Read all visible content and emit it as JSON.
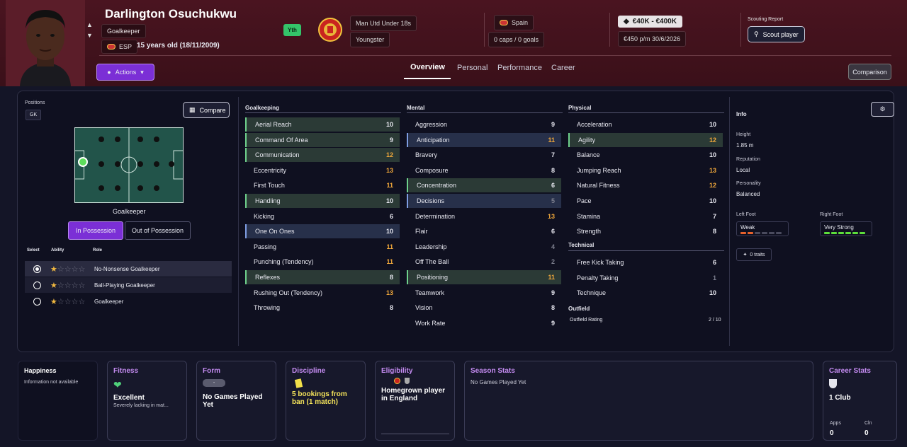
{
  "player": {
    "name": "Darlington Osuchukwu",
    "position": "Goalkeeper",
    "nation_code": "ESP",
    "age_text": "15 years old (18/11/2009)",
    "badge": "Yth"
  },
  "club": {
    "name": "Man Utd Under 18s",
    "status": "Youngster"
  },
  "nation": {
    "name": "Spain",
    "caps": "0 caps / 0 goals"
  },
  "value": {
    "range": "€40K - €400K",
    "wage_contract": "€450 p/m   30/6/2026"
  },
  "scouting": {
    "title": "Scouting Report",
    "button": "Scout player"
  },
  "actions_label": "Actions",
  "tabs": [
    "Overview",
    "Personal",
    "Performance",
    "Career"
  ],
  "comparison_label": "Comparison",
  "positions": {
    "label": "Positions",
    "value": "GK",
    "compare": "Compare",
    "pitch_label": "Goalkeeper",
    "in_possession": "In Possession",
    "out_possession": "Out of Possession"
  },
  "roles": {
    "headers": {
      "select": "Select",
      "ability": "Ability",
      "role": "Role"
    },
    "items": [
      {
        "name": "No-Nonsense Goalkeeper",
        "stars": 1,
        "selected": true
      },
      {
        "name": "Ball-Playing Goalkeeper",
        "stars": 1,
        "selected": false
      },
      {
        "name": "Goalkeeper",
        "stars": 1,
        "selected": false
      }
    ]
  },
  "goalkeeping": {
    "title": "Goalkeeping",
    "items": [
      {
        "name": "Aerial Reach",
        "value": "10",
        "style": "hl",
        "color": "w"
      },
      {
        "name": "Command Of Area",
        "value": "9",
        "style": "hl",
        "color": "w"
      },
      {
        "name": "Communication",
        "value": "12",
        "style": "hl",
        "color": "o"
      },
      {
        "name": "Eccentricity",
        "value": "13",
        "style": "",
        "color": "o"
      },
      {
        "name": "First Touch",
        "value": "11",
        "style": "",
        "color": "o"
      },
      {
        "name": "Handling",
        "value": "10",
        "style": "hl",
        "color": "w"
      },
      {
        "name": "Kicking",
        "value": "6",
        "style": "",
        "color": "w"
      },
      {
        "name": "One On Ones",
        "value": "10",
        "style": "hlb",
        "color": "w"
      },
      {
        "name": "Passing",
        "value": "11",
        "style": "",
        "color": "o"
      },
      {
        "name": "Punching (Tendency)",
        "value": "11",
        "style": "",
        "color": "o"
      },
      {
        "name": "Reflexes",
        "value": "8",
        "style": "hl",
        "color": "w"
      },
      {
        "name": "Rushing Out (Tendency)",
        "value": "13",
        "style": "",
        "color": "o"
      },
      {
        "name": "Throwing",
        "value": "8",
        "style": "",
        "color": "w"
      }
    ]
  },
  "mental": {
    "title": "Mental",
    "items": [
      {
        "name": "Aggression",
        "value": "9",
        "style": "",
        "color": "w"
      },
      {
        "name": "Anticipation",
        "value": "11",
        "style": "hlb",
        "color": "o"
      },
      {
        "name": "Bravery",
        "value": "7",
        "style": "",
        "color": "w"
      },
      {
        "name": "Composure",
        "value": "8",
        "style": "",
        "color": "w"
      },
      {
        "name": "Concentration",
        "value": "6",
        "style": "hl",
        "color": "w"
      },
      {
        "name": "Decisions",
        "value": "5",
        "style": "hlb",
        "color": "g"
      },
      {
        "name": "Determination",
        "value": "13",
        "style": "",
        "color": "o"
      },
      {
        "name": "Flair",
        "value": "6",
        "style": "",
        "color": "w"
      },
      {
        "name": "Leadership",
        "value": "4",
        "style": "",
        "color": "g"
      },
      {
        "name": "Off The Ball",
        "value": "2",
        "style": "",
        "color": "g"
      },
      {
        "name": "Positioning",
        "value": "11",
        "style": "hl",
        "color": "o"
      },
      {
        "name": "Teamwork",
        "value": "9",
        "style": "",
        "color": "w"
      },
      {
        "name": "Vision",
        "value": "8",
        "style": "",
        "color": "w"
      },
      {
        "name": "Work Rate",
        "value": "9",
        "style": "",
        "color": "w"
      }
    ]
  },
  "physical": {
    "title": "Physical",
    "items": [
      {
        "name": "Acceleration",
        "value": "10",
        "style": "",
        "color": "w"
      },
      {
        "name": "Agility",
        "value": "12",
        "style": "hl",
        "color": "o"
      },
      {
        "name": "Balance",
        "value": "10",
        "style": "",
        "color": "w"
      },
      {
        "name": "Jumping Reach",
        "value": "13",
        "style": "",
        "color": "o"
      },
      {
        "name": "Natural Fitness",
        "value": "12",
        "style": "",
        "color": "o"
      },
      {
        "name": "Pace",
        "value": "10",
        "style": "",
        "color": "w"
      },
      {
        "name": "Stamina",
        "value": "7",
        "style": "",
        "color": "w"
      },
      {
        "name": "Strength",
        "value": "8",
        "style": "",
        "color": "w"
      }
    ]
  },
  "technical": {
    "title": "Technical",
    "items": [
      {
        "name": "Free Kick Taking",
        "value": "6",
        "style": "",
        "color": "w"
      },
      {
        "name": "Penalty Taking",
        "value": "1",
        "style": "",
        "color": "g"
      },
      {
        "name": "Technique",
        "value": "10",
        "style": "",
        "color": "w"
      }
    ]
  },
  "outfield": {
    "title": "Outfield",
    "rating_label": "Outfield Rating",
    "rating": "2 / 10"
  },
  "info": {
    "title": "Info",
    "height_label": "Height",
    "height": "1.85 m",
    "reputation_label": "Reputation",
    "reputation": "Local",
    "personality_label": "Personality",
    "personality": "Balanced",
    "left_foot_label": "Left Foot",
    "left_foot": "Weak",
    "right_foot_label": "Right Foot",
    "right_foot": "Very Strong",
    "traits": "0 traits"
  },
  "cards": {
    "happiness": {
      "title": "Happiness",
      "text": "Information not available"
    },
    "fitness": {
      "title": "Fitness",
      "big": "Excellent",
      "small": "Severely lacking in mat..."
    },
    "form": {
      "title": "Form",
      "pill": "-",
      "big": "No Games Played Yet"
    },
    "discipline": {
      "title": "Discipline",
      "big": "5 bookings from ban (1 match)"
    },
    "eligibility": {
      "title": "Eligibility",
      "big": "Homegrown player in England"
    },
    "season": {
      "title": "Season Stats",
      "text": "No Games Played Yet"
    },
    "career": {
      "title": "Career Stats",
      "big": "1 Club",
      "apps_label": "Apps",
      "apps": "0",
      "cln_label": "Cln",
      "cln": "0"
    }
  },
  "colors": {
    "accent": "#7b2fd6",
    "orange": "#f2a93b",
    "green": "#6fd18c",
    "card_title": "#c58cf2"
  }
}
